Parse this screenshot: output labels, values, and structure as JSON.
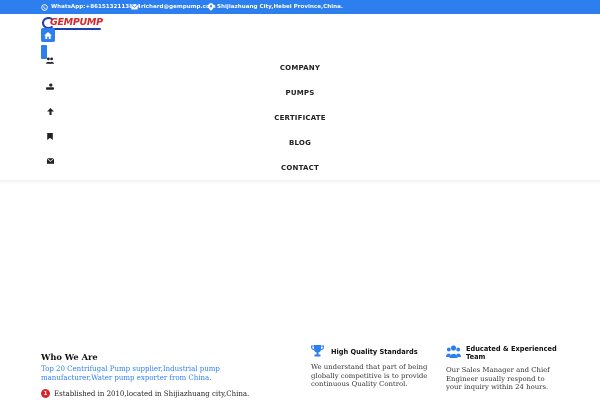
{
  "topbar": {
    "whatsapp": "WhatsApp:+8615132113824",
    "email": "richard@gempump.com",
    "address": "Shijiazhuang City,Hebei Province,China.",
    "background": "#2d7ff0"
  },
  "logo": {
    "text": "GEMPUMP"
  },
  "side_icons": [
    "home-icon",
    "users-icon",
    "user-profile-icon",
    "arrow-up-icon",
    "bookmark-icon",
    "envelope-icon"
  ],
  "nav": {
    "items": [
      "COMPANY",
      "PUMPS",
      "CERTIFICATE",
      "BLOG",
      "CONTACT"
    ]
  },
  "who": {
    "title": "Who We Are",
    "subtitle": "Top 20 Centrifugal Pump supplier,Industrial pump manufacturer,Water pump exporter from China.",
    "point_number": "1",
    "point_text": "Established in 2010,located in Shijiazhuang city,China."
  },
  "features": [
    {
      "icon": "trophy-icon",
      "title": "High Quality Standards",
      "text": "We understand that part of being globally competitive is to provide continuous Quality Control."
    },
    {
      "icon": "team-icon",
      "title": "Educated & Experienced Team",
      "text": "Our Sales Manager and Chief Engineer usually respond to your inquiry within 24 hours."
    }
  ],
  "colors": {
    "accent": "#2d7ff0",
    "logo_red": "#d62828",
    "logo_blue": "#1e40af"
  }
}
